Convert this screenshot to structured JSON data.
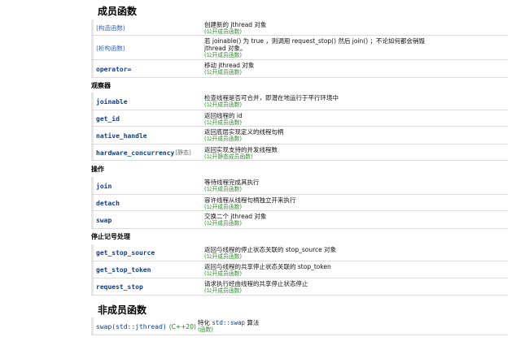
{
  "headings": {
    "members": "成员函数",
    "non_members": "非成员函数"
  },
  "groups": {
    "observers": "观察器",
    "operations": "操作",
    "stop_handling": "停止记号处理"
  },
  "rows": {
    "ctor": {
      "name": "(构造函数)",
      "text": "创建新的 jthread 对象",
      "kind": "(公开成员函数)"
    },
    "dtor": {
      "name": "(析构函数)",
      "text": "若 joinable() 为 true ，则调用 request_stop() 然后 join() ；不论如何都会销毁",
      "text2": "jthread 对象。",
      "kind": "(公开成员函数)"
    },
    "assign": {
      "name": "operator=",
      "text": "移动 jthread 对象",
      "kind": "(公开成员函数)"
    },
    "joinable": {
      "name": "joinable",
      "text": "检查线程是否可合并，即潜在地运行于平行环境中",
      "kind": "(公开成员函数)"
    },
    "get_id": {
      "name": "get_id",
      "text": "返回线程的 id",
      "kind": "(公开成员函数)"
    },
    "native_handle": {
      "name": "native_handle",
      "text": "返回底层实现定义的线程句柄",
      "kind": "(公开成员函数)"
    },
    "hardware_concurrency": {
      "name": "hardware_concurrency",
      "tag": "[静态]",
      "text": "返回实现支持的并发线程数",
      "kind": "(公开静态成员函数)"
    },
    "join": {
      "name": "join",
      "text": "等待线程完成其执行",
      "kind": "(公开成员函数)"
    },
    "detach": {
      "name": "detach",
      "text": "容许线程从线程句柄独立开来执行",
      "kind": "(公开成员函数)"
    },
    "swap": {
      "name": "swap",
      "text": "交换二个 jthread 对象",
      "kind": "(公开成员函数)"
    },
    "get_stop_source": {
      "name": "get_stop_source",
      "text": "返回与线程的停止状态关联的 stop_source 对象",
      "kind": "(公开成员函数)"
    },
    "get_stop_token": {
      "name": "get_stop_token",
      "text": "返回与线程的共享停止状态关联的 stop_token",
      "kind": "(公开成员函数)"
    },
    "request_stop": {
      "name": "request_stop",
      "text": "请求执行经由线程的共享停止状态停止",
      "kind": "(公开成员函数)"
    },
    "swap_nm": {
      "name": "swap(std::jthread)",
      "version": "(C++20)",
      "text_prefix": "特化 ",
      "text_code": "std::swap",
      "text_suffix": " 算法",
      "kind": "(函数)"
    }
  }
}
